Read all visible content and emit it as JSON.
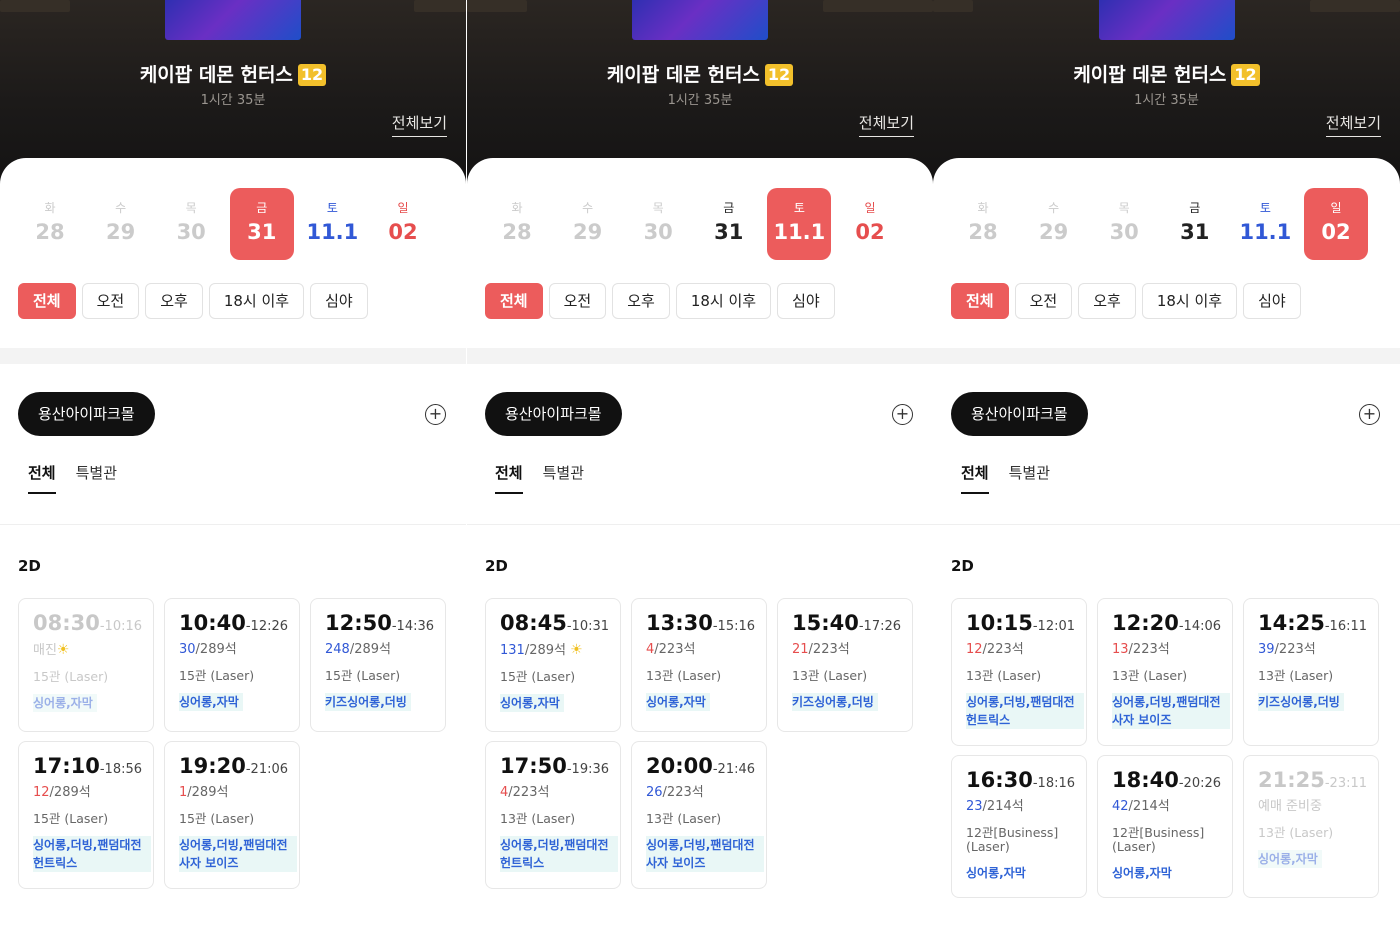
{
  "panels": [
    {
      "movie": {
        "title": "케이팝 데몬 헌터스",
        "rating": "12",
        "runtime": "1시간 35분",
        "see_all": "전체보기"
      },
      "dates": [
        {
          "dow": "화",
          "num": "28",
          "state": "past"
        },
        {
          "dow": "수",
          "num": "29",
          "state": "past"
        },
        {
          "dow": "목",
          "num": "30",
          "state": "past"
        },
        {
          "dow": "금",
          "num": "31",
          "state": "selected"
        },
        {
          "dow": "토",
          "num": "11.1",
          "state": "sat"
        },
        {
          "dow": "일",
          "num": "02",
          "state": "sun"
        }
      ],
      "filters": [
        "전체",
        "오전",
        "오후",
        "18시 이후",
        "심야"
      ],
      "theater": "용산아이파크몰",
      "tabs": [
        "전체",
        "특별관"
      ],
      "format": "2D",
      "showtimes": [
        {
          "start": "08:30",
          "end": "-10:16",
          "avail": "",
          "total": "매진",
          "hall": "15관 (Laser)",
          "tag": "싱어롱,자막",
          "disabled": true,
          "sun": true
        },
        {
          "start": "10:40",
          "end": "-12:26",
          "avail": "30",
          "total": "/289석",
          "hall": "15관 (Laser)",
          "tag": "싱어롱,자막"
        },
        {
          "start": "12:50",
          "end": "-14:36",
          "avail": "248",
          "total": "/289석",
          "hall": "15관 (Laser)",
          "tag": "키즈싱어롱,더빙"
        },
        {
          "start": "17:10",
          "end": "-18:56",
          "avail": "12",
          "total": "/289석",
          "hall": "15관 (Laser)",
          "tag": "싱어롱,더빙,팬덤대전 헌트릭스",
          "low": true
        },
        {
          "start": "19:20",
          "end": "-21:06",
          "avail": "1",
          "total": "/289석",
          "hall": "15관 (Laser)",
          "tag": "싱어롱,더빙,팬덤대전 사자 보이즈",
          "low": true
        }
      ]
    },
    {
      "movie": {
        "title": "케이팝 데몬 헌터스",
        "rating": "12",
        "runtime": "1시간 35분",
        "see_all": "전체보기"
      },
      "dates": [
        {
          "dow": "화",
          "num": "28",
          "state": "past"
        },
        {
          "dow": "수",
          "num": "29",
          "state": "past"
        },
        {
          "dow": "목",
          "num": "30",
          "state": "past"
        },
        {
          "dow": "금",
          "num": "31",
          "state": "normal"
        },
        {
          "dow": "토",
          "num": "11.1",
          "state": "selected"
        },
        {
          "dow": "일",
          "num": "02",
          "state": "sun"
        }
      ],
      "filters": [
        "전체",
        "오전",
        "오후",
        "18시 이후",
        "심야"
      ],
      "theater": "용산아이파크몰",
      "tabs": [
        "전체",
        "특별관"
      ],
      "format": "2D",
      "showtimes": [
        {
          "start": "08:45",
          "end": "-10:31",
          "avail": "131",
          "total": "/289석",
          "hall": "15관 (Laser)",
          "tag": "싱어롱,자막",
          "sun": true
        },
        {
          "start": "13:30",
          "end": "-15:16",
          "avail": "4",
          "total": "/223석",
          "hall": "13관 (Laser)",
          "tag": "싱어롱,자막",
          "low": true
        },
        {
          "start": "15:40",
          "end": "-17:26",
          "avail": "21",
          "total": "/223석",
          "hall": "13관 (Laser)",
          "tag": "키즈싱어롱,더빙",
          "low": true
        },
        {
          "start": "17:50",
          "end": "-19:36",
          "avail": "4",
          "total": "/223석",
          "hall": "13관 (Laser)",
          "tag": "싱어롱,더빙,팬덤대전 헌트릭스",
          "low": true
        },
        {
          "start": "20:00",
          "end": "-21:46",
          "avail": "26",
          "total": "/223석",
          "hall": "13관 (Laser)",
          "tag": "싱어롱,더빙,팬덤대전 사자 보이즈"
        }
      ]
    },
    {
      "movie": {
        "title": "케이팝 데몬 헌터스",
        "rating": "12",
        "runtime": "1시간 35분",
        "see_all": "전체보기"
      },
      "dates": [
        {
          "dow": "화",
          "num": "28",
          "state": "past"
        },
        {
          "dow": "수",
          "num": "29",
          "state": "past"
        },
        {
          "dow": "목",
          "num": "30",
          "state": "past"
        },
        {
          "dow": "금",
          "num": "31",
          "state": "normal"
        },
        {
          "dow": "토",
          "num": "11.1",
          "state": "sat"
        },
        {
          "dow": "일",
          "num": "02",
          "state": "selected"
        }
      ],
      "filters": [
        "전체",
        "오전",
        "오후",
        "18시 이후",
        "심야"
      ],
      "theater": "용산아이파크몰",
      "tabs": [
        "전체",
        "특별관"
      ],
      "format": "2D",
      "showtimes": [
        {
          "start": "10:15",
          "end": "-12:01",
          "avail": "12",
          "total": "/223석",
          "hall": "13관 (Laser)",
          "tag": "싱어롱,더빙,팬덤대전 헌트릭스",
          "low": true
        },
        {
          "start": "12:20",
          "end": "-14:06",
          "avail": "13",
          "total": "/223석",
          "hall": "13관 (Laser)",
          "tag": "싱어롱,더빙,팬덤대전 사자 보이즈",
          "low": true
        },
        {
          "start": "14:25",
          "end": "-16:11",
          "avail": "39",
          "total": "/223석",
          "hall": "13관 (Laser)",
          "tag": "키즈싱어롱,더빙"
        },
        {
          "start": "16:30",
          "end": "-18:16",
          "avail": "23",
          "total": "/214석",
          "hall": "12관[Business] (Laser)",
          "tag": "싱어롱,자막"
        },
        {
          "start": "18:40",
          "end": "-20:26",
          "avail": "42",
          "total": "/214석",
          "hall": "12관[Business] (Laser)",
          "tag": "싱어롱,자막"
        },
        {
          "start": "21:25",
          "end": "-23:11",
          "avail": "",
          "total": "예매 준비중",
          "hall": "13관 (Laser)",
          "tag": "싱어롱,자막",
          "disabled": true
        }
      ]
    }
  ],
  "colors": {
    "accent": "#ec5c5c",
    "saturday": "#3158d6",
    "sunday": "#e64e4e",
    "tag_text": "#2f63d6",
    "tag_bg": "#e9f7f6"
  },
  "icons": {
    "add": "plus-circle-icon",
    "sun": "sun-icon",
    "rating": "age-12-badge"
  }
}
